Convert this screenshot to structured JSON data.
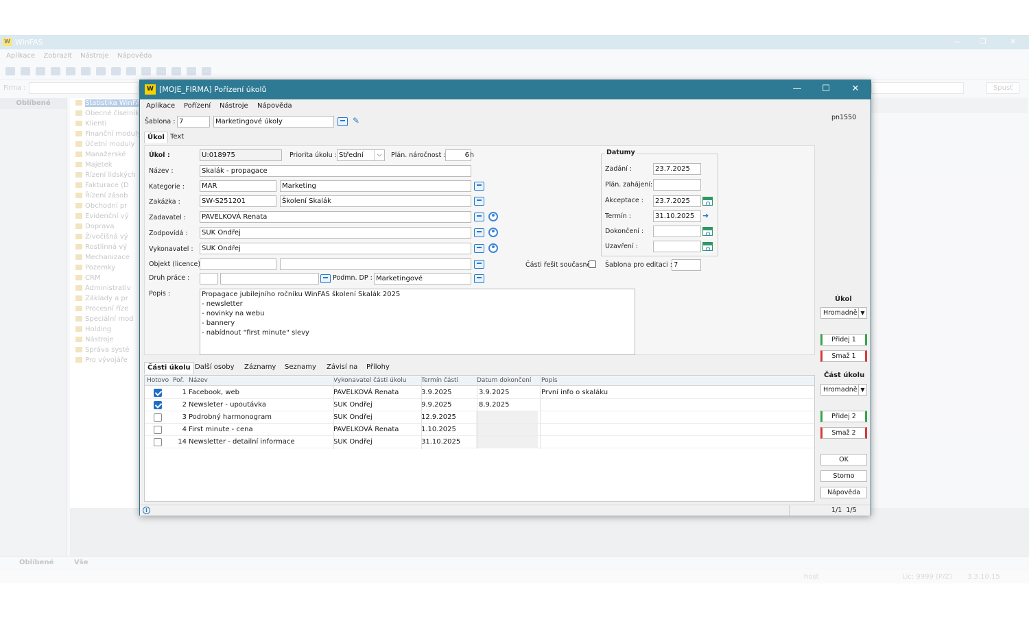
{
  "bg": {
    "title": "WinFAS",
    "menu": [
      "Aplikace",
      "Zobrazit",
      "Nástroje",
      "Nápověda"
    ],
    "firma_label": "Firma :",
    "spust": "Spusť",
    "left_header": "Oblíbené",
    "tree": [
      "Statistika WinFAS",
      "Obecné číselníky",
      "Klienti",
      "Finanční moduly",
      "Účetní moduly",
      "Manažerské",
      "Majetek",
      "Řízení lidských",
      "Fakturace (D",
      "Řízení zásob",
      "Obchodní pr",
      "Evidenční vý",
      "Doprava",
      "Živočišná vý",
      "Rostlinná vý",
      "Mechanizace",
      "Pozemky",
      "CRM",
      "Administrativ",
      "Základy a pr",
      "Procesní říze",
      "Speciální mod",
      "Holding",
      "Nástroje",
      "Správa systé",
      "Pro vývojáře"
    ],
    "bottom_tabs": [
      "Oblíbené",
      "Vše"
    ],
    "status_user": "host",
    "status_lic": "Lic: 9999 (P/Z)",
    "status_ver": "3.3.10.15"
  },
  "dialog": {
    "title": "[MOJE_FIRMA] Pořízení úkolů",
    "menu": [
      "Aplikace",
      "Pořízení",
      "Nástroje",
      "Nápověda"
    ],
    "sablona_label": "Šablona :",
    "sablona_id": "7",
    "sablona_name": "Marketingové úkoly",
    "pn": "pn1550",
    "tabs": [
      "Úkol",
      "Text"
    ],
    "form": {
      "ukol_label": "Úkol :",
      "ukol_value": "U:018975",
      "priorita_label": "Priorita úkolu :",
      "priorita_value": "Střední",
      "narocnost_label": "Plán. náročnost :",
      "narocnost_value": "6",
      "narocnost_unit": "h",
      "nazev_label": "Název :",
      "nazev_value": "Skalák - propagace",
      "kategorie_label": "Kategorie :",
      "kategorie_code": "MAR",
      "kategorie_name": "Marketing",
      "zakazka_label": "Zakázka :",
      "zakazka_code": "SW-S251201",
      "zakazka_name": "Školení Skalák",
      "zadavatel_label": "Zadavatel :",
      "zadavatel_value": "PAVELKOVÁ Renata",
      "zodpovida_label": "Zodpovídá :",
      "zodpovida_value": "SUK Ondřej",
      "vykonavatel_label": "Vykonavatel :",
      "vykonavatel_value": "SUK Ondřej",
      "objekt_label": "Objekt (licence):",
      "objekt_code": "",
      "objekt_name": "",
      "druh_label": "Druh práce :",
      "druh_code": "",
      "druh_name": "",
      "podmn_label": "Podmn. DP :",
      "podmn_value": "Marketingové",
      "casti_label": "Části řešit současně",
      "sablona_edit_label": "Šablona pro editaci :",
      "sablona_edit_value": "7",
      "popis_label": "Popis :",
      "popis_value": "Propagace jubilejního ročníku WinFAS školení Skalák 2025\n- newsletter\n- novinky na webu\n- bannery\n- nabídnout \"first minute\" slevy"
    },
    "datumy": {
      "title": "Datumy",
      "zadani_label": "Zadání :",
      "zadani_value": "23.7.2025",
      "plan_label": "Plán. zahájení:",
      "plan_value": "",
      "akceptace_label": "Akceptace :",
      "akceptace_value": "23.7.2025",
      "termin_label": "Termín :",
      "termin_value": "31.10.2025",
      "dokonceni_label": "Dokončení :",
      "dokonceni_value": "",
      "uzavreni_label": "Uzavření :",
      "uzavreni_value": ""
    },
    "subtabs": [
      "Části úkolu",
      "Další osoby",
      "Záznamy",
      "Seznamy",
      "Závisí na",
      "Přílohy"
    ],
    "grid": {
      "headers": [
        "Hotovo",
        "Poř.",
        "Název",
        "Vykonavatel části úkolu",
        "Termín části",
        "Datum dokončení",
        "Popis"
      ],
      "rows": [
        {
          "done": true,
          "por": "1",
          "nazev": "Facebook, web",
          "vyk": "PAVELKOVÁ Renata",
          "termin": "3.9.2025",
          "dokonceni": "3.9.2025",
          "popis": "První info o skaláku"
        },
        {
          "done": true,
          "por": "2",
          "nazev": "Newsleter - upoutávka",
          "vyk": "SUK Ondřej",
          "termin": "9.9.2025",
          "dokonceni": "8.9.2025",
          "popis": ""
        },
        {
          "done": false,
          "por": "3",
          "nazev": "Podrobný harmonogram",
          "vyk": "SUK Ondřej",
          "termin": "12.9.2025",
          "dokonceni": "",
          "popis": ""
        },
        {
          "done": false,
          "por": "4",
          "nazev": "First minute - cena",
          "vyk": "PAVELKOVÁ Renata",
          "termin": "1.10.2025",
          "dokonceni": "",
          "popis": ""
        },
        {
          "done": false,
          "por": "14",
          "nazev": "Newsletter - detailní informace",
          "vyk": "SUK Ondřej",
          "termin": "31.10.2025",
          "dokonceni": "",
          "popis": ""
        }
      ]
    },
    "right": {
      "ukol_title": "Úkol",
      "hromadne1": "Hromadně",
      "pridej1": "Přidej 1",
      "smaz1": "Smaž 1",
      "cast_title": "Část úkolu",
      "hromadne2": "Hromadně",
      "pridej2": "Přidej 2",
      "smaz2": "Smaž 2",
      "ok": "OK",
      "storno": "Storno",
      "napoveda": "Nápověda"
    },
    "status": {
      "info": "i",
      "pages": "1/1  1/5"
    }
  }
}
